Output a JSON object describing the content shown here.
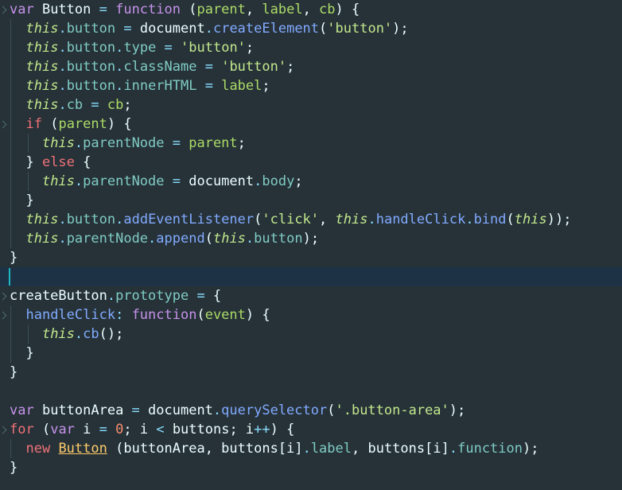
{
  "editor": {
    "lines": [
      [
        [
          "kw",
          "var "
        ],
        [
          "plain",
          "Button "
        ],
        [
          "op",
          "= "
        ],
        [
          "kw",
          "function "
        ],
        [
          "plain",
          "("
        ],
        [
          "param",
          "parent"
        ],
        [
          "plain",
          ", "
        ],
        [
          "param",
          "label"
        ],
        [
          "plain",
          ", "
        ],
        [
          "param",
          "cb"
        ],
        [
          "plain",
          ") {"
        ]
      ],
      [
        [
          "plain",
          "  "
        ],
        [
          "this",
          "this"
        ],
        [
          "op",
          "."
        ],
        [
          "prop",
          "button "
        ],
        [
          "op",
          "= "
        ],
        [
          "plain",
          "document"
        ],
        [
          "op",
          "."
        ],
        [
          "fn",
          "createElement"
        ],
        [
          "plain",
          "("
        ],
        [
          "str",
          "'button'"
        ],
        [
          "plain",
          ");"
        ]
      ],
      [
        [
          "plain",
          "  "
        ],
        [
          "this",
          "this"
        ],
        [
          "op",
          "."
        ],
        [
          "prop",
          "button"
        ],
        [
          "op",
          "."
        ],
        [
          "prop",
          "type "
        ],
        [
          "op",
          "= "
        ],
        [
          "str",
          "'button'"
        ],
        [
          "plain",
          ";"
        ]
      ],
      [
        [
          "plain",
          "  "
        ],
        [
          "this",
          "this"
        ],
        [
          "op",
          "."
        ],
        [
          "prop",
          "button"
        ],
        [
          "op",
          "."
        ],
        [
          "prop",
          "className "
        ],
        [
          "op",
          "= "
        ],
        [
          "str",
          "'button'"
        ],
        [
          "plain",
          ";"
        ]
      ],
      [
        [
          "plain",
          "  "
        ],
        [
          "this",
          "this"
        ],
        [
          "op",
          "."
        ],
        [
          "prop",
          "button"
        ],
        [
          "op",
          "."
        ],
        [
          "prop",
          "innerHTML "
        ],
        [
          "op",
          "= "
        ],
        [
          "param",
          "label"
        ],
        [
          "plain",
          ";"
        ]
      ],
      [
        [
          "plain",
          "  "
        ],
        [
          "this",
          "this"
        ],
        [
          "op",
          "."
        ],
        [
          "prop",
          "cb "
        ],
        [
          "op",
          "= "
        ],
        [
          "param",
          "cb"
        ],
        [
          "plain",
          ";"
        ]
      ],
      [
        [
          "plain",
          "  "
        ],
        [
          "ctl",
          "if "
        ],
        [
          "plain",
          "("
        ],
        [
          "param",
          "parent"
        ],
        [
          "plain",
          ") {"
        ]
      ],
      [
        [
          "plain",
          "    "
        ],
        [
          "this",
          "this"
        ],
        [
          "op",
          "."
        ],
        [
          "prop",
          "parentNode "
        ],
        [
          "op",
          "= "
        ],
        [
          "param",
          "parent"
        ],
        [
          "plain",
          ";"
        ]
      ],
      [
        [
          "plain",
          "  } "
        ],
        [
          "ctl",
          "else "
        ],
        [
          "plain",
          "{"
        ]
      ],
      [
        [
          "plain",
          "    "
        ],
        [
          "this",
          "this"
        ],
        [
          "op",
          "."
        ],
        [
          "prop",
          "parentNode "
        ],
        [
          "op",
          "= "
        ],
        [
          "plain",
          "document"
        ],
        [
          "op",
          "."
        ],
        [
          "prop",
          "body"
        ],
        [
          "plain",
          ";"
        ]
      ],
      [
        [
          "plain",
          "  }"
        ]
      ],
      [
        [
          "plain",
          "  "
        ],
        [
          "this",
          "this"
        ],
        [
          "op",
          "."
        ],
        [
          "prop",
          "button"
        ],
        [
          "op",
          "."
        ],
        [
          "fn",
          "addEventListener"
        ],
        [
          "plain",
          "("
        ],
        [
          "str",
          "'click'"
        ],
        [
          "plain",
          ", "
        ],
        [
          "this",
          "this"
        ],
        [
          "op",
          "."
        ],
        [
          "fn",
          "handleClick"
        ],
        [
          "op",
          "."
        ],
        [
          "fn",
          "bind"
        ],
        [
          "plain",
          "("
        ],
        [
          "this",
          "this"
        ],
        [
          "plain",
          "));"
        ]
      ],
      [
        [
          "plain",
          "  "
        ],
        [
          "this",
          "this"
        ],
        [
          "op",
          "."
        ],
        [
          "prop",
          "parentNode"
        ],
        [
          "op",
          "."
        ],
        [
          "fn",
          "append"
        ],
        [
          "plain",
          "("
        ],
        [
          "this",
          "this"
        ],
        [
          "op",
          "."
        ],
        [
          "prop",
          "button"
        ],
        [
          "plain",
          ");"
        ]
      ],
      [
        [
          "plain",
          "}"
        ]
      ],
      [],
      [
        [
          "plain",
          "createButton"
        ],
        [
          "op",
          "."
        ],
        [
          "prop",
          "prototype "
        ],
        [
          "op",
          "= "
        ],
        [
          "plain",
          "{"
        ]
      ],
      [
        [
          "plain",
          "  "
        ],
        [
          "fn",
          "handleClick"
        ],
        [
          "op",
          ": "
        ],
        [
          "kw",
          "function"
        ],
        [
          "plain",
          "("
        ],
        [
          "param",
          "event"
        ],
        [
          "plain",
          ") {"
        ]
      ],
      [
        [
          "plain",
          "    "
        ],
        [
          "this",
          "this"
        ],
        [
          "op",
          "."
        ],
        [
          "fn",
          "cb"
        ],
        [
          "plain",
          "();"
        ]
      ],
      [
        [
          "plain",
          "  }"
        ]
      ],
      [
        [
          "plain",
          "}"
        ]
      ],
      [],
      [
        [
          "kw",
          "var "
        ],
        [
          "plain",
          "buttonArea "
        ],
        [
          "op",
          "= "
        ],
        [
          "plain",
          "document"
        ],
        [
          "op",
          "."
        ],
        [
          "fn",
          "querySelector"
        ],
        [
          "plain",
          "("
        ],
        [
          "str",
          "'.button-area'"
        ],
        [
          "plain",
          ");"
        ]
      ],
      [
        [
          "ctl",
          "for "
        ],
        [
          "plain",
          "("
        ],
        [
          "kw",
          "var "
        ],
        [
          "plain",
          "i "
        ],
        [
          "op",
          "= "
        ],
        [
          "num",
          "0"
        ],
        [
          "plain",
          "; i "
        ],
        [
          "op",
          "< "
        ],
        [
          "plain",
          "buttons; i"
        ],
        [
          "op",
          "++"
        ],
        [
          "plain",
          ") {"
        ]
      ],
      [
        [
          "plain",
          "  "
        ],
        [
          "ctl",
          "new "
        ],
        [
          "cls",
          "Button"
        ],
        [
          "plain",
          " ("
        ],
        [
          "plain",
          "buttonArea"
        ],
        [
          "plain",
          ", buttons["
        ],
        [
          "plain",
          "i"
        ],
        [
          "plain",
          "]"
        ],
        [
          "op",
          "."
        ],
        [
          "prop",
          "label"
        ],
        [
          "plain",
          ", buttons["
        ],
        [
          "plain",
          "i"
        ],
        [
          "plain",
          "]"
        ],
        [
          "op",
          "."
        ],
        [
          "prop",
          "function"
        ],
        [
          "plain",
          ");"
        ]
      ],
      [
        [
          "plain",
          "}"
        ]
      ]
    ]
  }
}
